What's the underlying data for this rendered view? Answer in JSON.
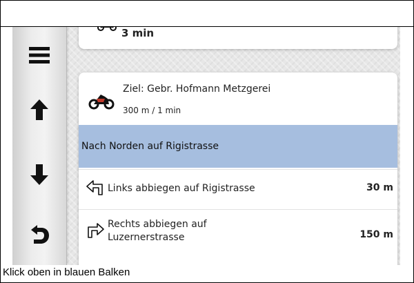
{
  "summary": {
    "eta_text": "3 min"
  },
  "sidebar": {
    "menu_icon": "menu-icon",
    "up_icon": "arrow-up-icon",
    "down_icon": "arrow-down-icon",
    "back_icon": "back-icon"
  },
  "destination": {
    "title": "Ziel: Gebr. Hofmann Metzgerei",
    "subtitle": "300 m / 1 min"
  },
  "directions": [
    {
      "label": "Nach Norden auf Rigistrasse",
      "distance": "",
      "selected": true
    },
    {
      "label": "Links abbiegen auf Rigistrasse",
      "distance": "30 m",
      "icon": "turn-left-icon"
    },
    {
      "label": "Rechts abbiegen auf Luzernerstrasse",
      "distance": "150 m",
      "icon": "turn-right-icon"
    }
  ],
  "caption": "Klick oben in blauen Balken",
  "colors": {
    "selected_row": "#a6bedf",
    "card": "#ffffff",
    "sidebar": "#ececec"
  }
}
